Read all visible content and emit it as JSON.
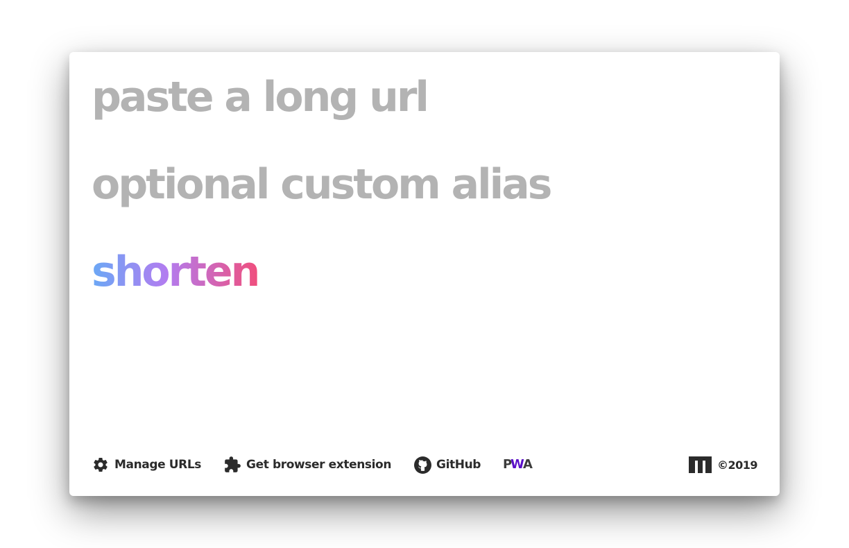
{
  "form": {
    "url_placeholder": "paste a long url",
    "url_value": "",
    "alias_placeholder": "optional custom alias",
    "alias_value": "",
    "submit_label": "shorten",
    "submit_gradient": [
      "#6aa8f5",
      "#b27cf0",
      "#f04f7d"
    ]
  },
  "footer": {
    "links": [
      {
        "label": "Manage URLs",
        "icon": "gear-icon"
      },
      {
        "label": "Get browser extension",
        "icon": "puzzle-piece-icon"
      },
      {
        "label": "GitHub",
        "icon": "github-icon"
      }
    ],
    "pwa_badge": {
      "icon": "pwa-logo",
      "text": "PWA",
      "colors": [
        "#3d3d3d",
        "#5a0fc8"
      ]
    },
    "copyright": "©2019",
    "author_logo": "m-logo"
  },
  "colors": {
    "placeholder": "#b3b3b3",
    "footer_text": "#2b2b2b",
    "card_bg": "#ffffff"
  }
}
